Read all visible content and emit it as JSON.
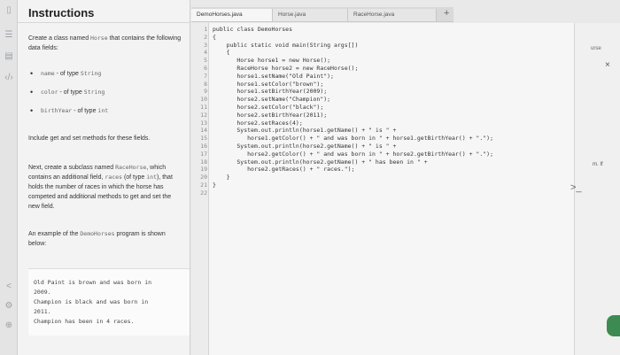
{
  "rail_icons": [
    "sidebar-toggle-icon",
    "list-icon",
    "book-icon",
    "code-icon",
    "share-icon",
    "settings-icon",
    "add-icon"
  ],
  "instructions": {
    "title": "Instructions",
    "intro_1": "Create a class named",
    "intro_class": "Horse",
    "intro_2": "that contains the following data fields:",
    "fields": [
      {
        "name": "name",
        "sep": " - of type ",
        "type": "String"
      },
      {
        "name": "color",
        "sep": " - of type ",
        "type": "String"
      },
      {
        "name": "birthYear",
        "sep": " - of type ",
        "type": "int"
      }
    ],
    "getset": "Include get and set methods for these fields.",
    "next_1": "Next, create a subclass named",
    "next_class": "RaceHorse",
    "next_2": ", which contains an additional field,",
    "next_field": "races",
    "next_3": "(of type",
    "next_type": "int",
    "next_4": "), that holds the number of races in which the horse has competed and additional methods to get and set the new field.",
    "example_1": "An example of the",
    "example_class": "DemoHorses",
    "example_2": "program is shown below:",
    "sample_output": [
      "Old Paint is brown and was born in",
      "2009.",
      "Champion is black and was born in",
      "2011.",
      "Champion has been in 4 races."
    ]
  },
  "tabs": [
    {
      "label": "DemoHorses.java",
      "active": true
    },
    {
      "label": "Horse.java",
      "active": false
    },
    {
      "label": "RaceHorse.java",
      "active": false
    }
  ],
  "tab_add": "+",
  "code_lines": [
    "public class DemoHorses",
    "{",
    "    public static void main(String args[])",
    "    {",
    "       Horse horse1 = new Horse();",
    "       RaceHorse horse2 = new RaceHorse();",
    "       horse1.setName(\"Old Paint\");",
    "       horse1.setColor(\"brown\");",
    "       horse1.setBirthYear(2009);",
    "       horse2.setName(\"Champion\");",
    "       horse2.setColor(\"black\");",
    "       horse2.setBirthYear(2011);",
    "       horse2.setRaces(4);",
    "       System.out.println(horse1.getName() + \" is \" +",
    "          horse1.getColor() + \" and was born in \" + horse1.getBirthYear() + \".\");",
    "       System.out.println(horse2.getName() + \" is \" +",
    "          horse2.getColor() + \" and was born in \" + horse2.getBirthYear() + \".\");",
    "       System.out.println(horse2.getName() + \" has been in \" +",
    "          horse2.getRaces() + \" races.\");",
    "    }",
    "}",
    ""
  ],
  "right_panel": {
    "label": "urse",
    "close": "×",
    "side_text": "m. If",
    "chevron": ">_"
  }
}
